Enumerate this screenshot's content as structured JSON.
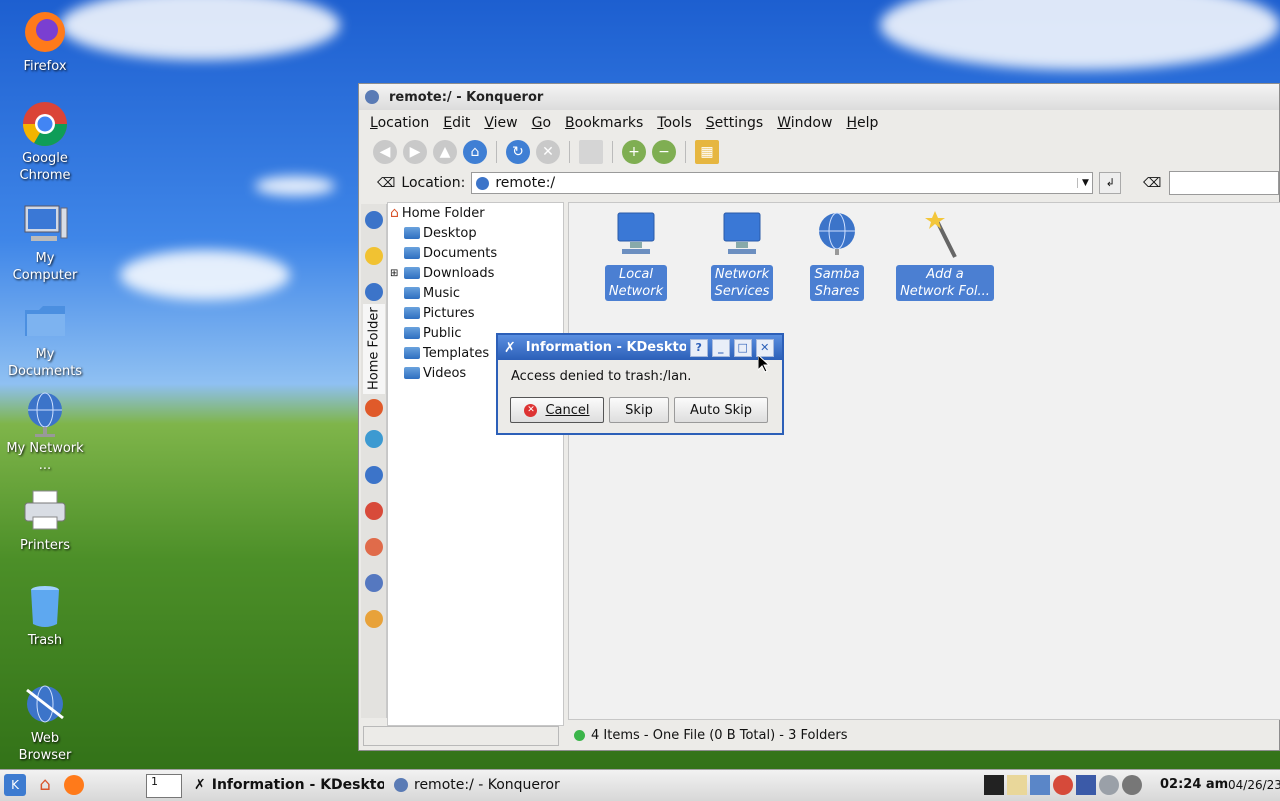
{
  "desktop": {
    "icons": [
      {
        "label": "Firefox"
      },
      {
        "label": "Google Chrome"
      },
      {
        "label": "My Computer"
      },
      {
        "label": "My Documents"
      },
      {
        "label": "My Network ..."
      },
      {
        "label": "Printers"
      },
      {
        "label": "Trash"
      },
      {
        "label": "Web Browser"
      }
    ]
  },
  "window": {
    "title": "remote:/ - Konqueror",
    "menu": [
      "Location",
      "Edit",
      "View",
      "Go",
      "Bookmarks",
      "Tools",
      "Settings",
      "Window",
      "Help"
    ],
    "location_label": "Location:",
    "location_value": "remote:/",
    "sidebar_tab_label": "Home Folder",
    "tree": {
      "root": "Home Folder",
      "items": [
        "Desktop",
        "Documents",
        "Downloads",
        "Music",
        "Pictures",
        "Public",
        "Templates",
        "Videos"
      ]
    },
    "files": [
      {
        "line1": "Local",
        "line2": "Network"
      },
      {
        "line1": "Network",
        "line2": "Services"
      },
      {
        "line1": "Samba",
        "line2": "Shares"
      },
      {
        "line1": "Add a",
        "line2": "Network Fol..."
      }
    ],
    "status": "4 Items - One File (0 B Total) - 3 Folders"
  },
  "dialog": {
    "title": "Information - KDeskto",
    "message": "Access denied to trash:/lan.",
    "cancel": "Cancel",
    "skip": "Skip",
    "auto_skip": "Auto Skip"
  },
  "taskbar": {
    "desktop_number": "1",
    "task1": "Information - KDesktop",
    "task2": "remote:/ - Konqueror",
    "time": "02:24 am",
    "date": "04/26/23"
  },
  "colors": {
    "accent": "#2c5fb8",
    "selection": "#4b7fd2"
  }
}
